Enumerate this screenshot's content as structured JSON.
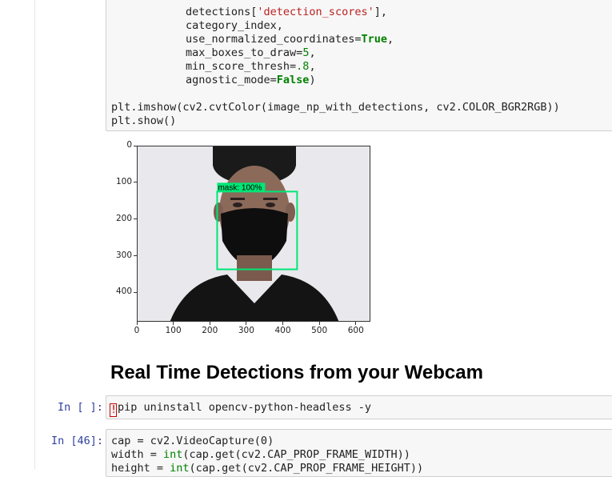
{
  "cells": {
    "top_code": {
      "line1_pre": "detections[",
      "line1_str": "'detection_scores'",
      "line1_post": "],",
      "line2": "category_index,",
      "line3_pre": "use_normalized_coordinates=",
      "line3_kw": "True",
      "line3_post": ",",
      "line4_pre": "max_boxes_to_draw=",
      "line4_num": "5",
      "line4_post": ",",
      "line5_pre": "min_score_thresh=",
      "line5_num": ".8",
      "line5_post": ",",
      "line6_pre": "agnostic_mode=",
      "line6_kw": "False",
      "line6_post": ")",
      "line7": "plt.imshow(cv2.cvtColor(image_np_with_detections, cv2.COLOR_BGR2RGB))",
      "line8": "plt.show()"
    },
    "plot": {
      "detection_label": "mask: 100%",
      "box_color": "#00e676"
    },
    "heading": "Real Time Detections from your Webcam",
    "pip_cell": {
      "prompt": "In [ ]:",
      "cursor_char": "!",
      "code": "pip uninstall opencv-python-headless -y"
    },
    "capture_cell": {
      "prompt": "In [46]:",
      "line1": "cap = cv2.VideoCapture(0)",
      "line2_pre": "width = ",
      "line2_fn": "int",
      "line2_post": "(cap.get(cv2.CAP_PROP_FRAME_WIDTH))",
      "line3_pre": "height = ",
      "line3_fn": "int",
      "line3_post": "(cap.get(cv2.CAP_PROP_FRAME_HEIGHT))"
    }
  },
  "chart_data": {
    "type": "image",
    "x_ticks": [
      "0",
      "100",
      "200",
      "300",
      "400",
      "500",
      "600"
    ],
    "y_ticks": [
      "0",
      "100",
      "200",
      "300",
      "400"
    ],
    "x_tick_values": [
      0,
      100,
      200,
      300,
      400,
      500,
      600
    ],
    "y_tick_values": [
      0,
      100,
      200,
      300,
      400
    ],
    "xlim": [
      0,
      640
    ],
    "ylim": [
      480,
      0
    ],
    "detection_box": {
      "x1": 218,
      "y1": 123,
      "x2": 437,
      "y2": 335,
      "label": "mask: 100%"
    }
  }
}
